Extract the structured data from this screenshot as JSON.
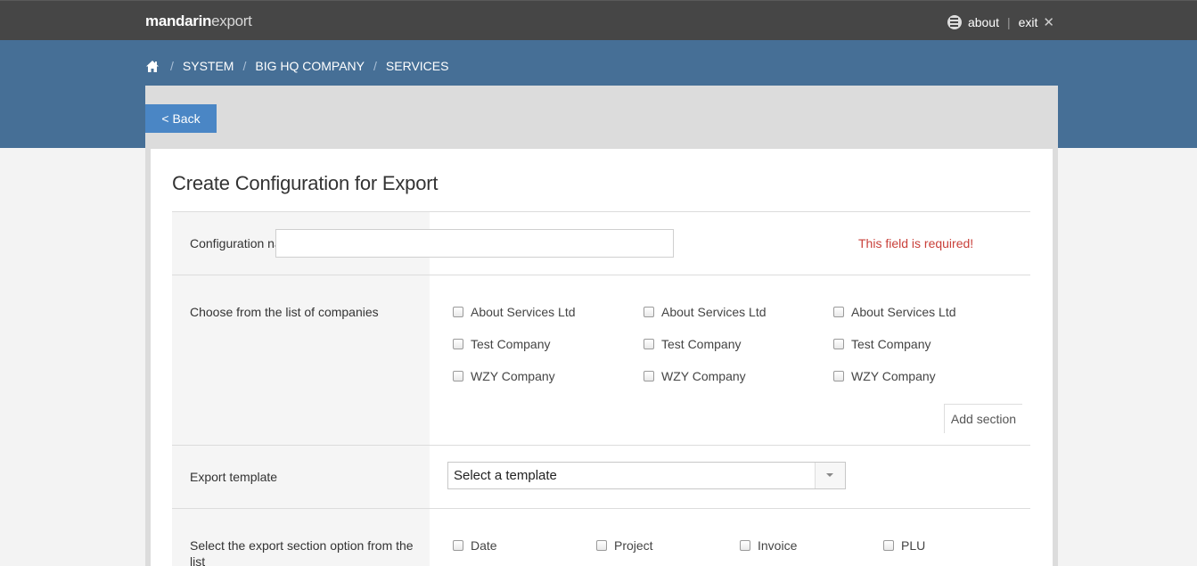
{
  "header": {
    "logo_bold": "mandarin",
    "logo_light": "export",
    "about": "about",
    "separator": "|",
    "exit": "exit",
    "exit_icon": "close-icon"
  },
  "breadcrumb": {
    "home_icon": "home-icon",
    "items": [
      "SYSTEM",
      "BIG HQ COMPANY",
      "SERVICES"
    ],
    "separator": "/"
  },
  "back_label": "< Back",
  "page_title": "Create Configuration for Export",
  "form": {
    "config_name": {
      "label": "Configuration name",
      "value": "",
      "error": "This field is required!"
    },
    "companies": {
      "label": "Choose from the list of companies",
      "options": [
        [
          "About Services Ltd",
          "About Services Ltd",
          "About Services Ltd"
        ],
        [
          "Test Company",
          "Test Company",
          "Test Company"
        ],
        [
          "WZY Company",
          "WZY Company",
          "WZY Company"
        ]
      ],
      "add_section": "Add section"
    },
    "template": {
      "label": "Export template",
      "selected": "Select a template"
    },
    "sections": {
      "label": "Select the export section option from the list",
      "options": [
        "Date",
        "Project",
        "Invoice",
        "PLU"
      ]
    }
  },
  "colors": {
    "topbar": "#464646",
    "header_blue": "#466f96",
    "button_blue": "#4a86c5",
    "error_red": "#c9403a"
  }
}
